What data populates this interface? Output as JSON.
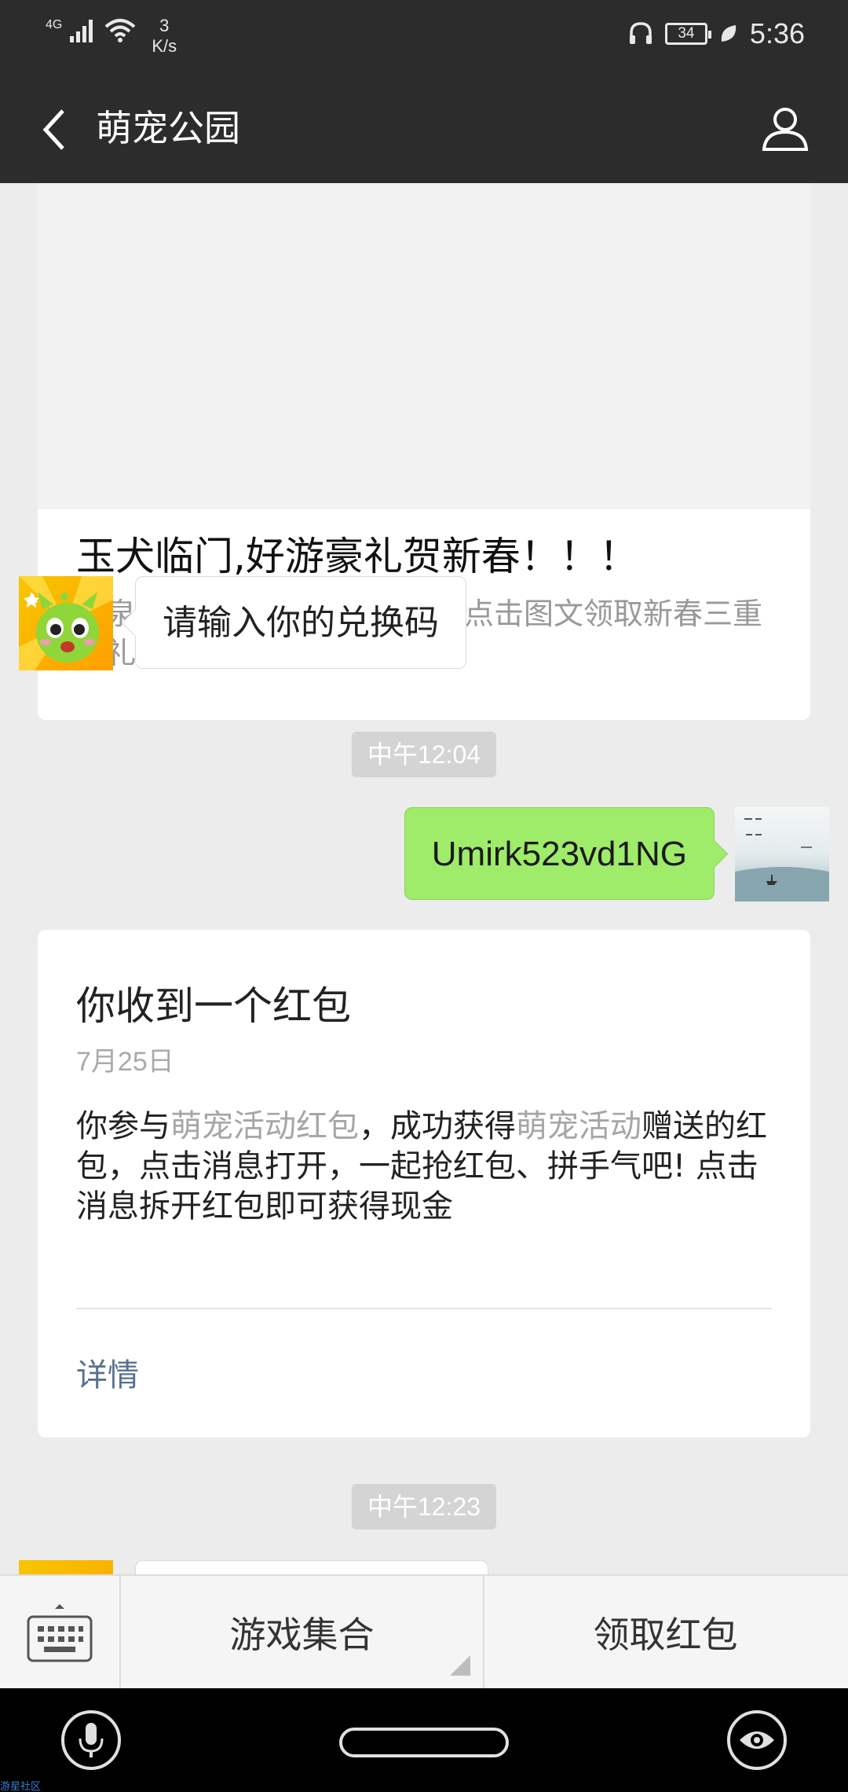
{
  "status_bar": {
    "network": "4G",
    "speed_value": "3",
    "speed_unit": "K/s",
    "battery": "34",
    "time": "5:36"
  },
  "header": {
    "title": "萌宠公园",
    "back_icon": "back-arrow-icon",
    "profile_icon": "person-icon"
  },
  "messages": {
    "article": {
      "title": "玉犬临门,好游豪礼贺新春！！！",
      "description": "玉泉临门，好游新春送豪礼！点击图文领取新春三重大礼包！"
    },
    "incoming_1": "请输入你的兑换码",
    "time_1": "中午12:04",
    "outgoing_1": "Umirk523vd1NG",
    "red_packet": {
      "title": "你收到一个红包",
      "date": "7月25日",
      "body_1": "你参与",
      "body_hl_1": "萌宠活动红包",
      "body_2": "，成功获得",
      "body_hl_2": "萌宠活动",
      "body_3": "赠送的红包，点击消息打开，一起抢红包、拼手气吧! 点击消息拆开红包即可获得现金",
      "detail": "详情"
    },
    "time_2": "中午12:23"
  },
  "bottom_menu": {
    "keyboard_icon": "keyboard-icon",
    "item_1": "游戏集合",
    "item_2": "领取红包"
  },
  "navbar": {
    "mic_icon": "mic-icon",
    "eye_icon": "eye-icon"
  },
  "watermark": "游星社区",
  "colors": {
    "header_bg": "#2c2c2c",
    "chat_bg": "#ececec",
    "outgoing_bubble": "#9feb6a",
    "link": "#57708f"
  }
}
